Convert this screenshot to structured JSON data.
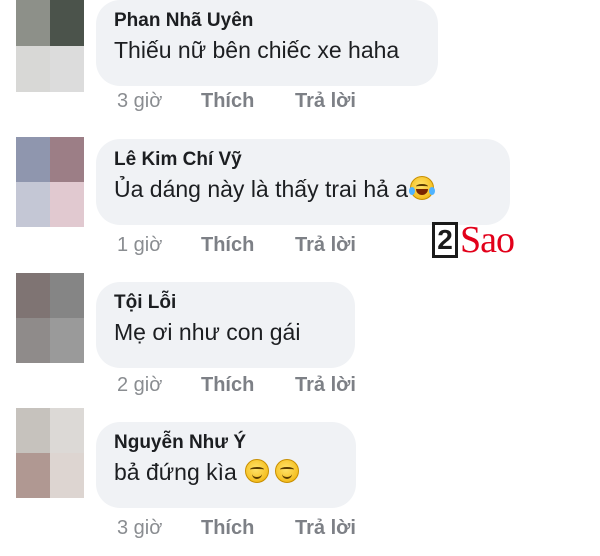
{
  "comments": [
    {
      "name": "Phan Nhã Uyên",
      "text": "Thiếu nữ bên chiếc xe haha",
      "time": "3 giờ",
      "like": "Thích",
      "reply": "Trả lời",
      "emojis": [],
      "avatar_colors": [
        "#8d9089",
        "#4b534b",
        "#d8d8d6",
        "#dcdcdc"
      ]
    },
    {
      "name": "Lê Kim Chí Vỹ",
      "text": "Ủa dáng này là thấy trai hả a",
      "time": "1 giờ",
      "like": "Thích",
      "reply": "Trả lời",
      "emojis": [
        "face-with-tears-of-joy-icon"
      ],
      "avatar_colors": [
        "#8f96ae",
        "#9c7e86",
        "#c4c7d5",
        "#e1c9d0"
      ]
    },
    {
      "name": "Tội Lỗi",
      "text": "Mẹ ơi như con gái",
      "time": "2 giờ",
      "like": "Thích",
      "reply": "Trả lời",
      "emojis": [],
      "avatar_colors": [
        "#7f7473",
        "#858585",
        "#8f8b8a",
        "#9a9a9a"
      ]
    },
    {
      "name": "Nguyễn Như Ý",
      "text": "bả đứng kìa",
      "time": "3 giờ",
      "like": "Thích",
      "reply": "Trả lời",
      "emojis": [
        "smiling-face-icon",
        "smiling-face-icon"
      ],
      "avatar_colors": [
        "#c6c2bd",
        "#dcd9d6",
        "#b09892",
        "#ddd5d1"
      ]
    }
  ],
  "watermark": {
    "number": "2",
    "text": "Sao"
  }
}
